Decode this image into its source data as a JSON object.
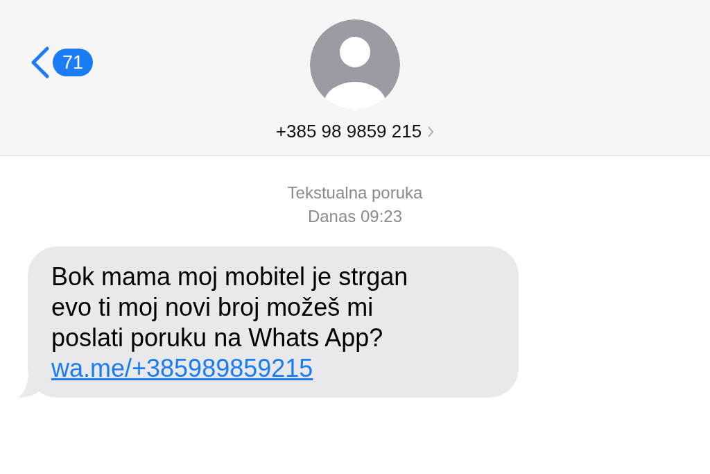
{
  "header": {
    "back_badge": "71",
    "contact": "+385 98 9859 215"
  },
  "thread_info": {
    "service": "Tekstualna poruka",
    "timestamp": "Danas 09:23"
  },
  "messages": [
    {
      "kind": "incoming",
      "lines": [
        "Bok mama moj mobitel je strgan",
        "evo ti moj novi broj možeš mi",
        "poslati poruku na Whats App?"
      ],
      "link": "wa.me/+385989859215"
    }
  ]
}
